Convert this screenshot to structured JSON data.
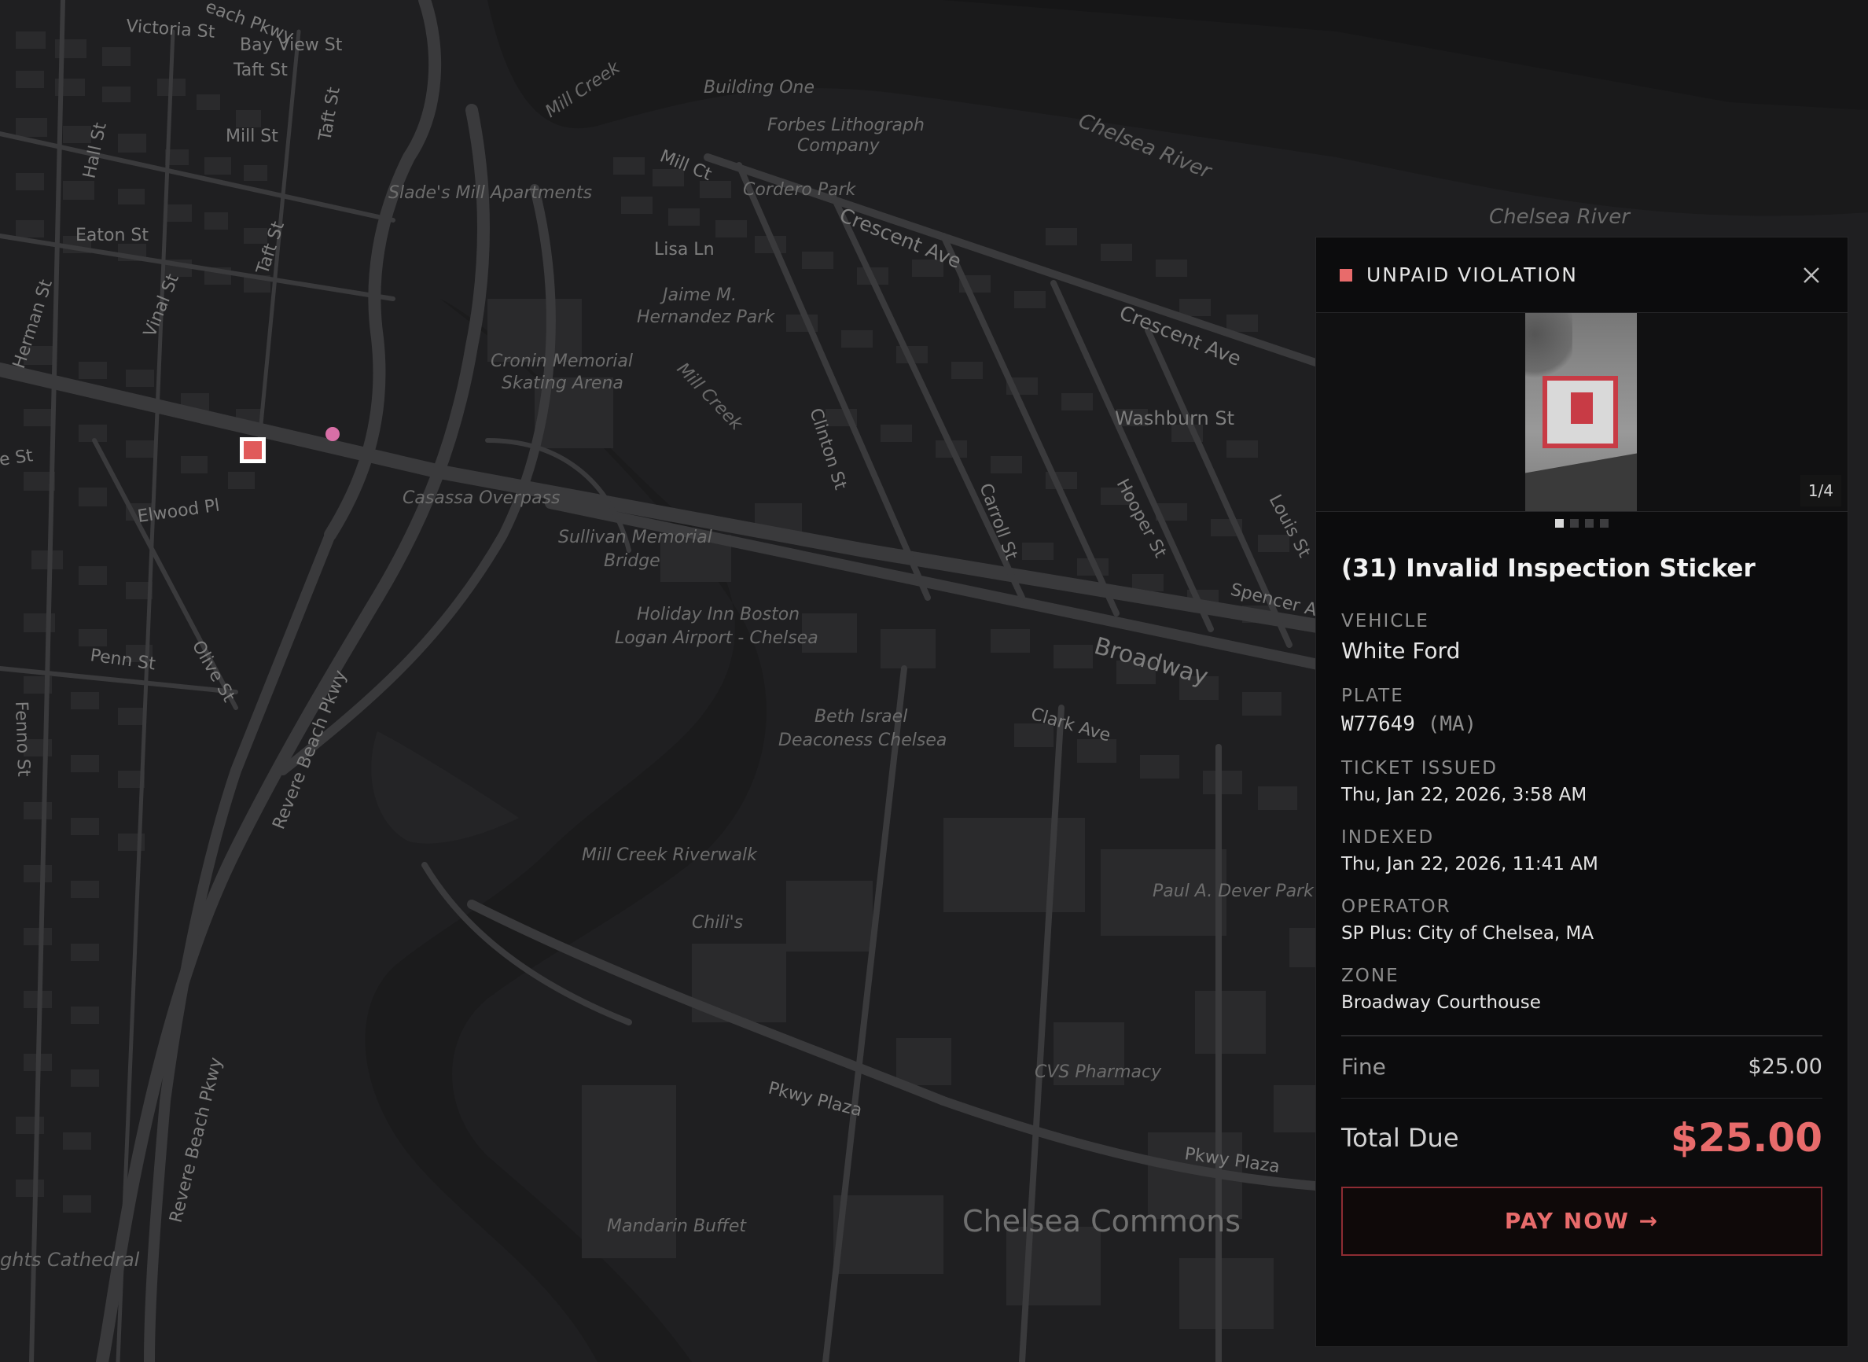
{
  "map": {
    "labels": {
      "beach_pkwy_top": "each Pkwy",
      "victoria_st": "Victoria St",
      "bay_view_st": "Bay View St",
      "taft_st_top": "Taft St",
      "mill_st": "Mill St",
      "taft_st_vert": "Taft St",
      "hall_st": "Hall St",
      "eaton_st": "Eaton St",
      "taft_st_mid": "Taft St",
      "vinal_st": "Vinal St",
      "herman_st": "Herman St",
      "e_st": "e St",
      "elwood_pl": "Elwood Pl",
      "penn_st": "Penn St",
      "olive_st": "Olive St",
      "fenno_st": "Fenno St",
      "revere_beach_pkwy_1": "Revere Beach Pkwy",
      "revere_beach_pkwy_2": "Revere Beach Pkwy",
      "mill_creek_1": "Mill Creek",
      "mill_creek_2": "Mill Creek",
      "building_one": "Building One",
      "forbes_1": "Forbes Lithograph",
      "forbes_2": "Company",
      "mill_ct": "Mill Ct",
      "cordero_park": "Cordero Park",
      "slades": "Slade's Mill Apartments",
      "lisa_ln": "Lisa Ln",
      "jaime_1": "Jaime M.",
      "jaime_2": "Hernandez Park",
      "cronin_1": "Cronin Memorial",
      "cronin_2": "Skating Arena",
      "casassa": "Casassa Overpass",
      "sullivan_1": "Sullivan Memorial",
      "sullivan_2": "Bridge",
      "holiday_1": "Holiday Inn Boston",
      "holiday_2": "Logan Airport - Chelsea",
      "beth_1": "Beth Israel",
      "beth_2": "Deaconess Chelsea",
      "riverwalk": "Mill Creek Riverwalk",
      "chilis": "Chili's",
      "mandarin": "Mandarin Buffet",
      "chelsea_commons": "Chelsea Commons",
      "cvs": "CVS Pharmacy",
      "pkwy_plaza_1": "Pkwy Plaza",
      "pkwy_plaza_2": "Pkwy Plaza",
      "paul_dever": "Paul A. Dever Park",
      "clark_ave": "Clark Ave",
      "broadway": "Broadway",
      "spencer": "Spencer A",
      "crescent_ave_1": "Crescent Ave",
      "crescent_ave_2": "Crescent Ave",
      "washburn_st": "Washburn St",
      "clinton_st": "Clinton St",
      "carroll_st": "Carroll St",
      "hooper_st": "Hooper St",
      "louis_st": "Louis St",
      "chelsea_river_1": "Chelsea River",
      "chelsea_river_2": "Chelsea River",
      "cathedral": "ghts Cathedral"
    }
  },
  "panel": {
    "status": "UNPAID VIOLATION",
    "status_color": "#e86b6b",
    "close_icon": "close-icon",
    "photo_counter": "1/4",
    "photo_count": 4,
    "photo_active_index": 0,
    "title": "(31) Invalid Inspection Sticker",
    "vehicle_label": "VEHICLE",
    "vehicle_value": "White Ford",
    "plate_label": "PLATE",
    "plate_number": "W77649",
    "plate_state": "(MA)",
    "ticket_issued_label": "TICKET ISSUED",
    "ticket_issued_value": "Thu, Jan 22, 2026, 3:58 AM",
    "indexed_label": "INDEXED",
    "indexed_value": "Thu, Jan 22, 2026, 11:41 AM",
    "operator_label": "OPERATOR",
    "operator_value": "SP Plus: City of Chelsea, MA",
    "zone_label": "ZONE",
    "zone_value": "Broadway Courthouse",
    "fine_label": "Fine",
    "fine_value": "$25.00",
    "total_label": "Total Due",
    "total_value": "$25.00",
    "pay_label": "PAY NOW →"
  },
  "colors": {
    "map_bg": "#1f1f21",
    "accent_red": "#e86b6b",
    "marker_pink": "#d86fa6"
  }
}
